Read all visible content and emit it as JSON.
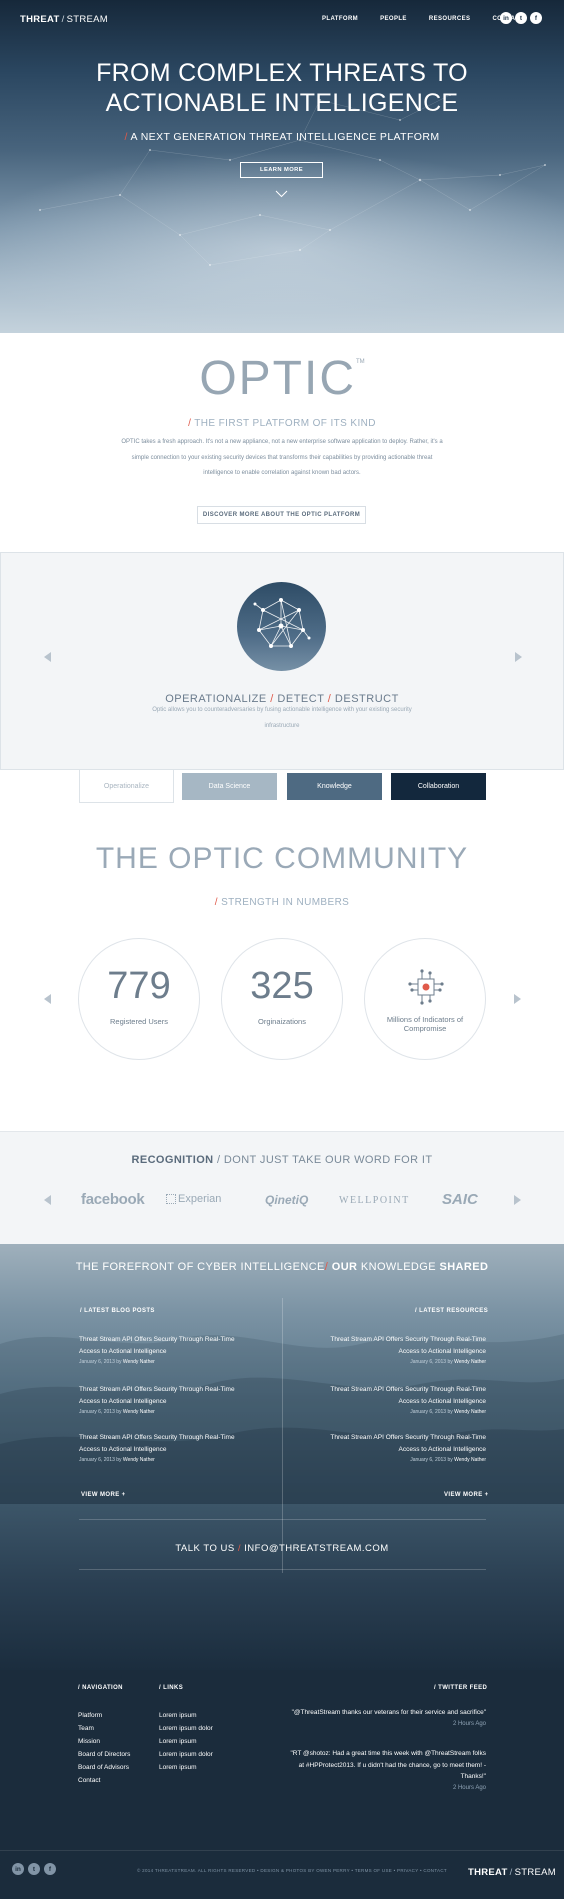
{
  "header": {
    "logo_bold": "THREAT",
    "logo_slash": "/",
    "logo_rest": "STREAM",
    "nav": [
      "PLATFORM",
      "PEOPLE",
      "RESOURCES",
      "CONTACT"
    ],
    "social_icons": [
      "linkedin-icon",
      "twitter-icon",
      "facebook-icon"
    ]
  },
  "hero": {
    "title_line1": "FROM COMPLEX THREATS TO",
    "title_line2": "ACTIONABLE INTELLIGENCE",
    "subtitle_slash": "/",
    "subtitle": "A NEXT GENERATION THREAT INTELLIGENCE PLATFORM",
    "button": "LEARN MORE"
  },
  "optic": {
    "title": "OPTIC",
    "tm": "TM",
    "tag_slash": "/",
    "tagline": "THE FIRST PLATFORM OF ITS KIND",
    "body": "OPTIC takes a fresh approach. It's not a new appliance, not a new enterprise software application to deploy. Rather, it's a simple connection to your existing security devices that transforms their capabilities by providing actionable threat intelligence to enable correlation against known bad actors.",
    "button": "DISCOVER MORE ABOUT THE OPTIC PLATFORM"
  },
  "feature": {
    "title_a": "OPERATIONALIZE",
    "slash1": "/",
    "title_b": "DETECT",
    "slash2": "/",
    "title_c": "DESTRUCT",
    "description": "Optic allows you to counteradversaries by fusing  actionable intelligence with your existing security infrastructure",
    "tabs": [
      "Operationalize",
      "Data Science",
      "Knowledge",
      "Collaboration"
    ],
    "active_tab": "Operationalize"
  },
  "community": {
    "title": "THE OPTIC COMMUNITY",
    "tag_slash": "/",
    "tagline": "STRENGTH IN NUMBERS",
    "stats": [
      {
        "value": "779",
        "label": "Registered Users"
      },
      {
        "value": "325",
        "label": "Orginaizations"
      },
      {
        "value": "",
        "label": "Millions of Indicators of Compromise",
        "icon": "chip-icon"
      }
    ]
  },
  "recognition": {
    "title_bold": "RECOGNITION",
    "slash": "/",
    "title_rest": "DONT JUST TAKE OUR WORD FOR IT",
    "logos": [
      "facebook",
      "Experian",
      "QinetiQ",
      "WELLPOINT",
      "SAIC"
    ]
  },
  "knowledge": {
    "title_a": "THE FOREFRONT OF CYBER INTELLIGENCE",
    "slash": "/",
    "title_b_bold": "OUR",
    "title_c": "KNOWLEDGE",
    "title_d_bold": "SHARED",
    "blog_heading": "/ LATEST BLOG POSTS",
    "resources_heading": "/ LATEST RESOURCES",
    "posts": [
      {
        "title": "Threat Stream API Offers Security Through Real-Time Access to Actional Intelligence",
        "date": "January 6, 2013 by",
        "author": "Wendy Nather"
      },
      {
        "title": "Threat Stream API Offers Security Through Real-Time Access to Actional Intelligence",
        "date": "January 6, 2013 by",
        "author": "Wendy Nather"
      },
      {
        "title": "Threat Stream API Offers Security Through Real-Time Access to Actional Intelligence",
        "date": "January 6, 2013 by",
        "author": "Wendy Nather"
      }
    ],
    "resources": [
      {
        "title": "Threat Stream API Offers Security Through Real-Time Access to Actional Intelligence",
        "date": "January 6, 2013 by",
        "author": "Wendy Nather"
      },
      {
        "title": "Threat Stream API Offers Security Through Real-Time Access to Actional Intelligence",
        "date": "January 6, 2013 by",
        "author": "Wendy Nather"
      },
      {
        "title": "Threat Stream API Offers Security Through Real-Time Access to Actional Intelligence",
        "date": "January 6, 2013 by",
        "author": "Wendy Nather"
      }
    ],
    "view_more": "VIEW MORE +",
    "talk_a": "TALK TO US",
    "talk_slash": "/",
    "talk_email": "INFO@THREATSTREAM.COM"
  },
  "footer": {
    "nav_heading": "/ NAVIGATION",
    "links_heading": "/ LINKS",
    "twitter_heading": "/ TWITTER FEED",
    "nav": [
      "Platform",
      "Team",
      "Mission",
      "Board of Directors",
      "Board of Advisors",
      "Contact"
    ],
    "links": [
      "Lorem ipsum",
      "Lorem ipsum dolor",
      "Lorem ipsum",
      "Lorem ipsum dolor",
      "Lorem ipsum"
    ],
    "tweets": [
      {
        "text": "\"@ThreatStream thanks our veterans for their service and sacrifice\"",
        "ago": "2 Hours Ago"
      },
      {
        "text": "\"RT @shotoz: Had a great time this week with @ThreatStream  folks at #HPProtect2013. If u didn't had the chance, go to meet them! - Thanks!\"",
        "ago": "2 Hours Ago"
      }
    ],
    "copyright": "© 2014 THREATSTREAM. ALL RIGHTS RESERVED  •  DESIGN & PHOTOS BY OWEN PERRY  •  TERMS OF USE  •  PRIVACY  •  CONTACT",
    "logo_a": "THREAT",
    "logo_slash": "/",
    "logo_b": "STREAM"
  },
  "colors": {
    "accent_slash": "#e05a4a",
    "navy": "#13283d",
    "tab_light": "#a6b7c4",
    "tab_mid": "#4e6a82"
  }
}
